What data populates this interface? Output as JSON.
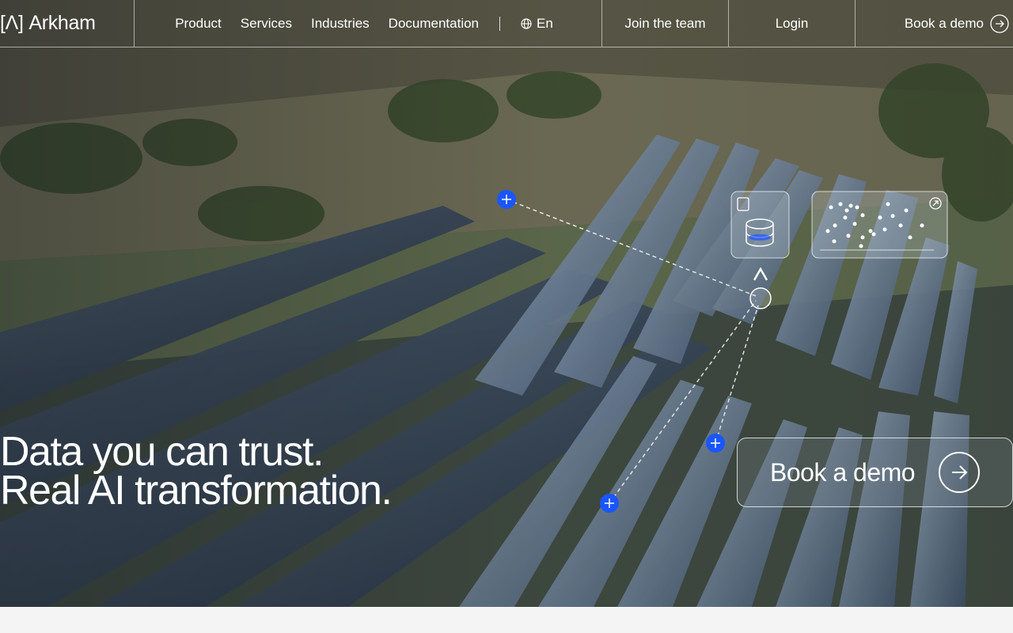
{
  "brand": {
    "logo_text": "[Λ] Arkham"
  },
  "nav": {
    "items": [
      {
        "label": "Product"
      },
      {
        "label": "Services"
      },
      {
        "label": "Industries"
      },
      {
        "label": "Documentation"
      }
    ],
    "language": "En",
    "join_label": "Join the team",
    "login_label": "Login",
    "demo_label": "Book a demo"
  },
  "hero": {
    "headline_line1": "Data you can trust.",
    "headline_line2": "Real AI transformation.",
    "cta_label": "Book a demo"
  },
  "colors": {
    "accent_blue": "#1a56ff",
    "text": "#ffffff",
    "page_background": "#f4f4f4"
  },
  "icons": [
    "globe-icon",
    "arrow-right-circle-icon",
    "database-icon",
    "scatter-plot-icon",
    "expand-icon",
    "arkham-lambda-icon",
    "plus-node-icon"
  ]
}
